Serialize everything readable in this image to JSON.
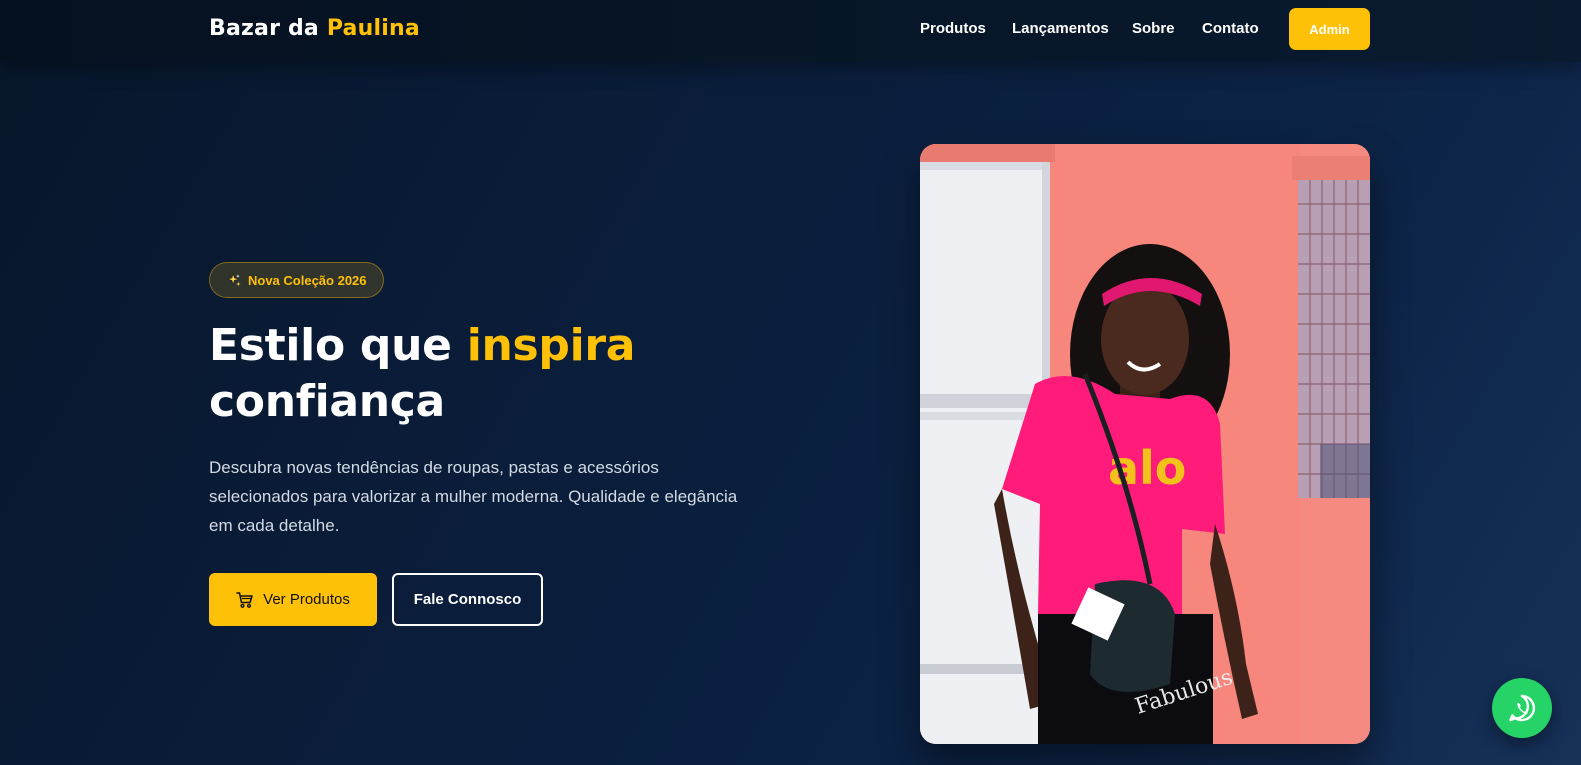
{
  "header": {
    "logo_prefix": "Bazar da",
    "logo_accent": "Paulina",
    "nav": [
      {
        "label": "Produtos"
      },
      {
        "label": "Lançamentos"
      },
      {
        "label": "Sobre"
      },
      {
        "label": "Contato"
      }
    ],
    "admin_label": "Admin"
  },
  "hero": {
    "badge_icon": "sparkles-icon",
    "badge_label": "Nova Coleção 2026",
    "title_prefix": "Estilo que",
    "title_accent": "inspira",
    "title_suffix": "confiança",
    "description": "Descubra novas tendências de roupas, pastas e acessórios selecionados para valorizar a mulher moderna. Qualidade e elegância em cada detalhe.",
    "primary_button": {
      "icon": "cart-icon",
      "label": "Ver Produtos"
    },
    "secondary_button": {
      "label": "Fale Connosco"
    },
    "image_shirt_text": "alo"
  },
  "floating": {
    "whatsapp_icon": "whatsapp-icon"
  },
  "colors": {
    "accent": "#ffc107",
    "background": "#0a1e3c",
    "whatsapp": "#25d366"
  }
}
